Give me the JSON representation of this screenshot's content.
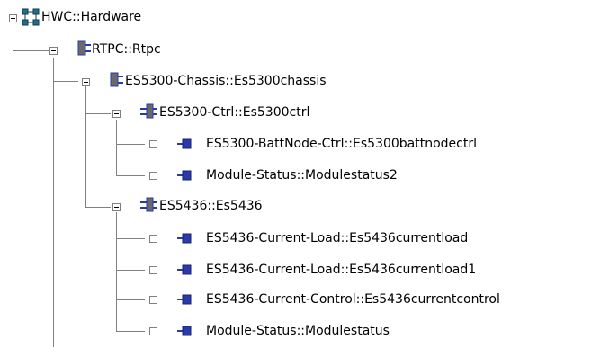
{
  "tree": {
    "root": {
      "label": "HWC::Hardware",
      "icon": "hardware-network-icon",
      "expanded": true
    },
    "rtpc": {
      "label": "RTPC::Rtpc",
      "icon": "module-block-icon",
      "expanded": true
    },
    "chassis": {
      "label": "ES5300-Chassis::Es5300chassis",
      "icon": "module-block-icon",
      "expanded": true
    },
    "ctrl": {
      "label": "ES5300-Ctrl::Es5300ctrl",
      "icon": "module-cross-icon",
      "expanded": true
    },
    "battnode": {
      "label": "ES5300-BattNode-Ctrl::Es5300battnodectrl",
      "icon": "leaf-module-icon"
    },
    "modstatus2": {
      "label": "Module-Status::Modulestatus2",
      "icon": "leaf-module-icon"
    },
    "es5436": {
      "label": "ES5436::Es5436",
      "icon": "module-cross-icon",
      "expanded": true
    },
    "curload": {
      "label": "ES5436-Current-Load::Es5436currentload",
      "icon": "leaf-module-icon"
    },
    "curload1": {
      "label": "ES5436-Current-Load::Es5436currentload1",
      "icon": "leaf-module-icon"
    },
    "curctrl": {
      "label": "ES5436-Current-Control::Es5436currentcontrol",
      "icon": "leaf-module-icon"
    },
    "modstatus": {
      "label": "Module-Status::Modulestatus",
      "icon": "leaf-module-icon"
    }
  },
  "colors": {
    "connector": "#808080",
    "module_block": "#6a6a6a",
    "module_blue": "#2a3aa8",
    "hardware_teal": "#1f6f8b"
  }
}
